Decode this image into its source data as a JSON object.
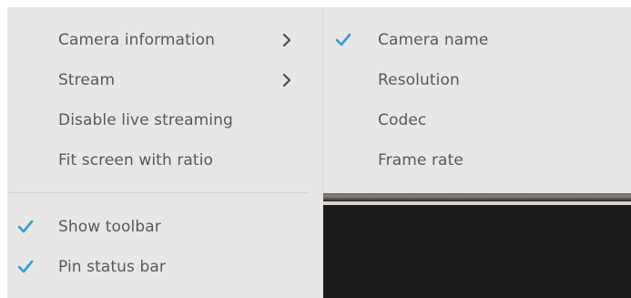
{
  "main_menu": {
    "items": [
      {
        "label": "Camera information",
        "has_submenu": true
      },
      {
        "label": "Stream",
        "has_submenu": true
      },
      {
        "label": "Disable live streaming",
        "has_submenu": false
      },
      {
        "label": "Fit screen with ratio",
        "has_submenu": false
      }
    ],
    "toggles": [
      {
        "label": "Show toolbar",
        "checked": true
      },
      {
        "label": "Pin status bar",
        "checked": true
      }
    ]
  },
  "submenu": {
    "items": [
      {
        "label": "Camera name",
        "checked": true
      },
      {
        "label": "Resolution",
        "checked": false
      },
      {
        "label": "Codec",
        "checked": false
      },
      {
        "label": "Frame rate",
        "checked": false
      }
    ]
  },
  "colors": {
    "menu_background": "#e7e7e7",
    "text": "#555a60",
    "checkmark": "#2f9fd8",
    "chevron": "#4a4f55",
    "video_background": "#1b1b1b"
  },
  "icons": {
    "check": "check-icon",
    "chevron": "chevron-right-icon"
  }
}
